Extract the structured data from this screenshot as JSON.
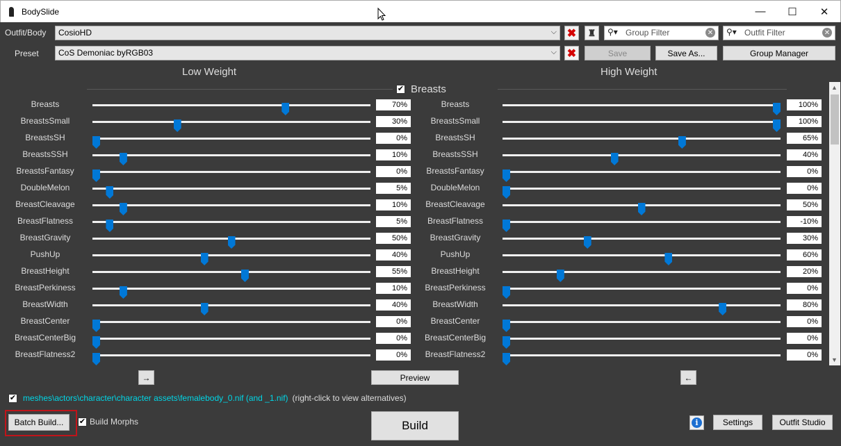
{
  "window": {
    "title": "BodySlide",
    "min": "—",
    "max": "☐",
    "close": "✕"
  },
  "outfit": {
    "label": "Outfit/Body",
    "value": "CosioHD"
  },
  "preset": {
    "label": "Preset",
    "value": "CoS Demoniac byRGB03"
  },
  "filters": {
    "group_placeholder": "Group Filter",
    "outfit_placeholder": "Outfit Filter"
  },
  "buttons": {
    "save": "Save",
    "save_as": "Save As...",
    "group_manager": "Group Manager",
    "preview": "Preview",
    "build": "Build",
    "batch_build": "Batch Build...",
    "settings": "Settings",
    "outfit_studio": "Outfit Studio",
    "arrow_right": "→",
    "arrow_left": "←"
  },
  "columns": {
    "low": "Low Weight",
    "high": "High Weight"
  },
  "group": {
    "name": "Breasts",
    "checked": true
  },
  "sliders": [
    {
      "name": "Breasts",
      "low": 70,
      "low_text": "70%",
      "high": 100,
      "high_text": "100%"
    },
    {
      "name": "BreastsSmall",
      "low": 30,
      "low_text": "30%",
      "high": 100,
      "high_text": "100%"
    },
    {
      "name": "BreastsSH",
      "low": 0,
      "low_text": "0%",
      "high": 65,
      "high_text": "65%"
    },
    {
      "name": "BreastsSSH",
      "low": 10,
      "low_text": "10%",
      "high": 40,
      "high_text": "40%"
    },
    {
      "name": "BreastsFantasy",
      "low": 0,
      "low_text": "0%",
      "high": 0,
      "high_text": "0%"
    },
    {
      "name": "DoubleMelon",
      "low": 5,
      "low_text": "5%",
      "high": 0,
      "high_text": "0%"
    },
    {
      "name": "BreastCleavage",
      "low": 10,
      "low_text": "10%",
      "high": 50,
      "high_text": "50%"
    },
    {
      "name": "BreastFlatness",
      "low": 5,
      "low_text": "5%",
      "high": 0,
      "high_text": "-10%"
    },
    {
      "name": "BreastGravity",
      "low": 50,
      "low_text": "50%",
      "high": 30,
      "high_text": "30%"
    },
    {
      "name": "PushUp",
      "low": 40,
      "low_text": "40%",
      "high": 60,
      "high_text": "60%"
    },
    {
      "name": "BreastHeight",
      "low": 55,
      "low_text": "55%",
      "high": 20,
      "high_text": "20%"
    },
    {
      "name": "BreastPerkiness",
      "low": 10,
      "low_text": "10%",
      "high": 0,
      "high_text": "0%"
    },
    {
      "name": "BreastWidth",
      "low": 40,
      "low_text": "40%",
      "high": 80,
      "high_text": "80%"
    },
    {
      "name": "BreastCenter",
      "low": 0,
      "low_text": "0%",
      "high": 0,
      "high_text": "0%"
    },
    {
      "name": "BreastCenterBig",
      "low": 0,
      "low_text": "0%",
      "high": 0,
      "high_text": "0%"
    },
    {
      "name": "BreastFlatness2",
      "low": 0,
      "low_text": "0%",
      "high": 0,
      "high_text": "0%"
    }
  ],
  "output": {
    "path": "meshes\\actors\\character\\character assets\\femalebody_0.nif (and _1.nif)",
    "hint": "(right-click to view alternatives)",
    "checked": true
  },
  "build_morphs": {
    "label": "Build Morphs",
    "checked": true
  },
  "colors": {
    "accent": "#0078d7",
    "link": "#00d6e6",
    "highlight": "#c0141a",
    "background": "#3b3b3b"
  }
}
